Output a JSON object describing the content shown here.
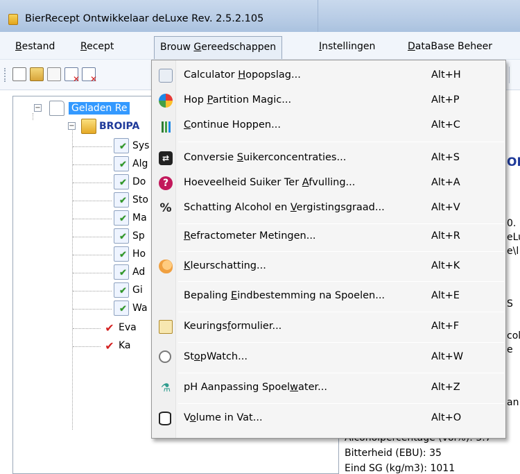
{
  "window": {
    "title": "BierRecept Ontwikkelaar deLuxe Rev. 2.5.2.105"
  },
  "menubar": {
    "items": [
      {
        "pre": "",
        "acc": "B",
        "post": "estand"
      },
      {
        "pre": "",
        "acc": "R",
        "post": "ecept"
      },
      {
        "pre": "Brouw ",
        "acc": "G",
        "post": "ereedschappen"
      },
      {
        "pre": "",
        "acc": "I",
        "post": "nstellingen"
      },
      {
        "pre": "",
        "acc": "D",
        "post": "ataBase Beheer"
      }
    ]
  },
  "toolbar": {
    "icons": [
      "new-file-icon",
      "open-folder-icon",
      "copy-icon",
      "delete-recipe-icon",
      "delete-item-icon"
    ]
  },
  "tree": {
    "root": "Geladen Re",
    "recipe": "BROIPA",
    "children": [
      "Sys",
      "Alg",
      "Do",
      "Sto",
      "Ma",
      "Sp",
      "Ho",
      "Ad",
      "Gi",
      "Wa",
      "Eva",
      "Ka"
    ]
  },
  "right_panel": {
    "lines": [
      "OIF",
      "0.",
      "eLu",
      "e\\l",
      "S",
      "col",
      "e",
      "an",
      "Alcoholpercentage (vol%): 5.7",
      "Bitterheid (EBU): 35",
      "Eind SG (kg/m3): 1011"
    ]
  },
  "dropdown": {
    "items": [
      {
        "icon": "hop-scale-icon",
        "pre": "Calculator ",
        "acc": "H",
        "post": "opopslag...",
        "shortcut": "Alt+H"
      },
      {
        "icon": "pie-chart-icon",
        "pre": "Hop ",
        "acc": "P",
        "post": "artition Magic...",
        "shortcut": "Alt+P"
      },
      {
        "icon": "bar-chart-icon",
        "pre": "",
        "acc": "C",
        "post": "ontinue Hoppen...",
        "shortcut": "Alt+C"
      },
      {
        "icon": "conversion-icon",
        "pre": "Conversie ",
        "acc": "S",
        "post": "uikerconcentraties...",
        "shortcut": "Alt+S"
      },
      {
        "icon": "question-icon",
        "pre": "Hoeveelheid Suiker Ter ",
        "acc": "A",
        "post": "fvulling...",
        "shortcut": "Alt+A"
      },
      {
        "icon": "percent-icon",
        "pre": "Schatting Alcohol en ",
        "acc": "V",
        "post": "ergistingsgraad...",
        "shortcut": "Alt+V"
      },
      {
        "icon": "",
        "pre": "",
        "acc": "R",
        "post": "efractometer Metingen...",
        "shortcut": "Alt+R"
      },
      {
        "icon": "palette-icon",
        "pre": "",
        "acc": "K",
        "post": "leurschatting...",
        "shortcut": "Alt+K"
      },
      {
        "icon": "",
        "pre": "Bepaling ",
        "acc": "E",
        "post": "indbestemming na Spoelen...",
        "shortcut": "Alt+E"
      },
      {
        "icon": "form-icon",
        "pre": "Keurings",
        "acc": "f",
        "post": "ormulier...",
        "shortcut": "Alt+F"
      },
      {
        "icon": "stopwatch-icon",
        "pre": "St",
        "acc": "o",
        "post": "pWatch...",
        "shortcut": "Alt+W"
      },
      {
        "icon": "flask-icon",
        "pre": "pH Aanpassing Spoel",
        "acc": "w",
        "post": "ater...",
        "shortcut": "Alt+Z"
      },
      {
        "icon": "cylinder-icon",
        "pre": "V",
        "acc": "o",
        "post": "lume in Vat...",
        "shortcut": "Alt+O"
      }
    ],
    "icon_glyphs": {
      "percent": "%",
      "flask": "⚗",
      "question": "?",
      "convert": "⇄"
    }
  }
}
